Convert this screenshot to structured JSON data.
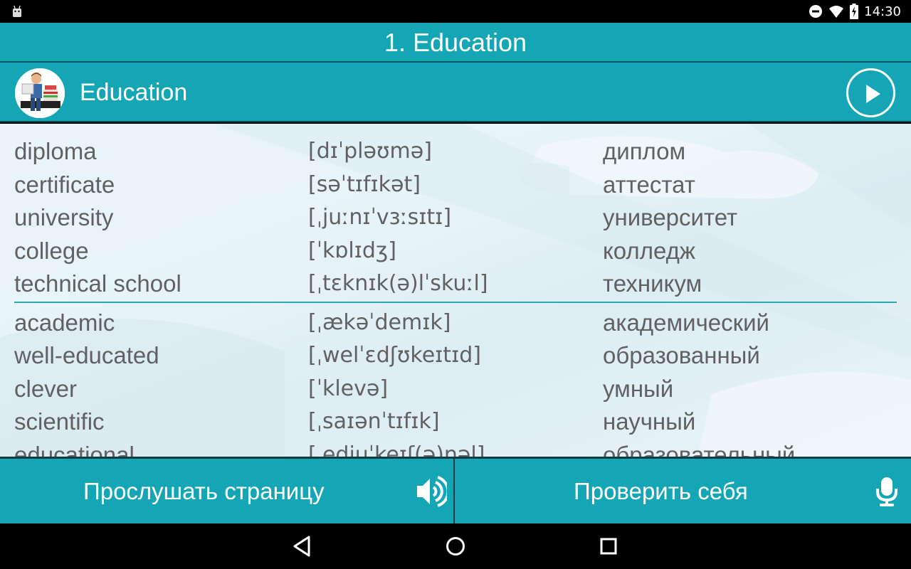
{
  "status_bar": {
    "time": "14:30",
    "icons": [
      "android-debug-icon",
      "do-not-disturb-icon",
      "wifi-icon",
      "battery-charging-icon"
    ]
  },
  "title_bar": {
    "title": "1. Education"
  },
  "lesson": {
    "title": "Education",
    "avatar": "boy-reading-books-image",
    "play_icon": "play-icon"
  },
  "vocabulary": {
    "groups": [
      {
        "rows": [
          {
            "word": "diploma",
            "ipa": "[dɪˈpləʊmə]",
            "translation": "диплом"
          },
          {
            "word": "certificate",
            "ipa": "[səˈtɪfɪkət]",
            "translation": "аттестат"
          },
          {
            "word": "university",
            "ipa": "[ˌjuːnɪˈvɜːsɪtɪ]",
            "translation": "университет"
          },
          {
            "word": "college",
            "ipa": "[ˈkɒlɪdʒ]",
            "translation": "колледж"
          },
          {
            "word": "technical school",
            "ipa": "[ˌtɛknɪk(ə)lˈskuːl]",
            "translation": "техникум"
          }
        ]
      },
      {
        "rows": [
          {
            "word": "academic",
            "ipa": "[ˌækəˈdemɪk]",
            "translation": "академический"
          },
          {
            "word": "well-educated",
            "ipa": "[ˌwelˈɛdʃʊkeɪtɪd]",
            "translation": "образованный"
          },
          {
            "word": "clever",
            "ipa": "[ˈklevə]",
            "translation": "умный"
          },
          {
            "word": "scientific",
            "ipa": "[ˌsaɪənˈtɪfɪk]",
            "translation": "научный"
          },
          {
            "word": "educational",
            "ipa": "[ˌedjuˈkeɪʃ(ə)nəl]",
            "translation": "образовательный"
          }
        ]
      }
    ]
  },
  "bottom_bar": {
    "listen_label": "Прослушать страницу",
    "listen_icon": "speaker-icon",
    "check_label": "Проверить себя",
    "check_icon": "microphone-icon"
  },
  "nav_bar": {
    "back": "back-icon",
    "home": "home-icon",
    "recents": "recents-icon"
  },
  "colors": {
    "accent": "#15a6b5",
    "text": "#616161",
    "divider": "#2aa8b8"
  }
}
